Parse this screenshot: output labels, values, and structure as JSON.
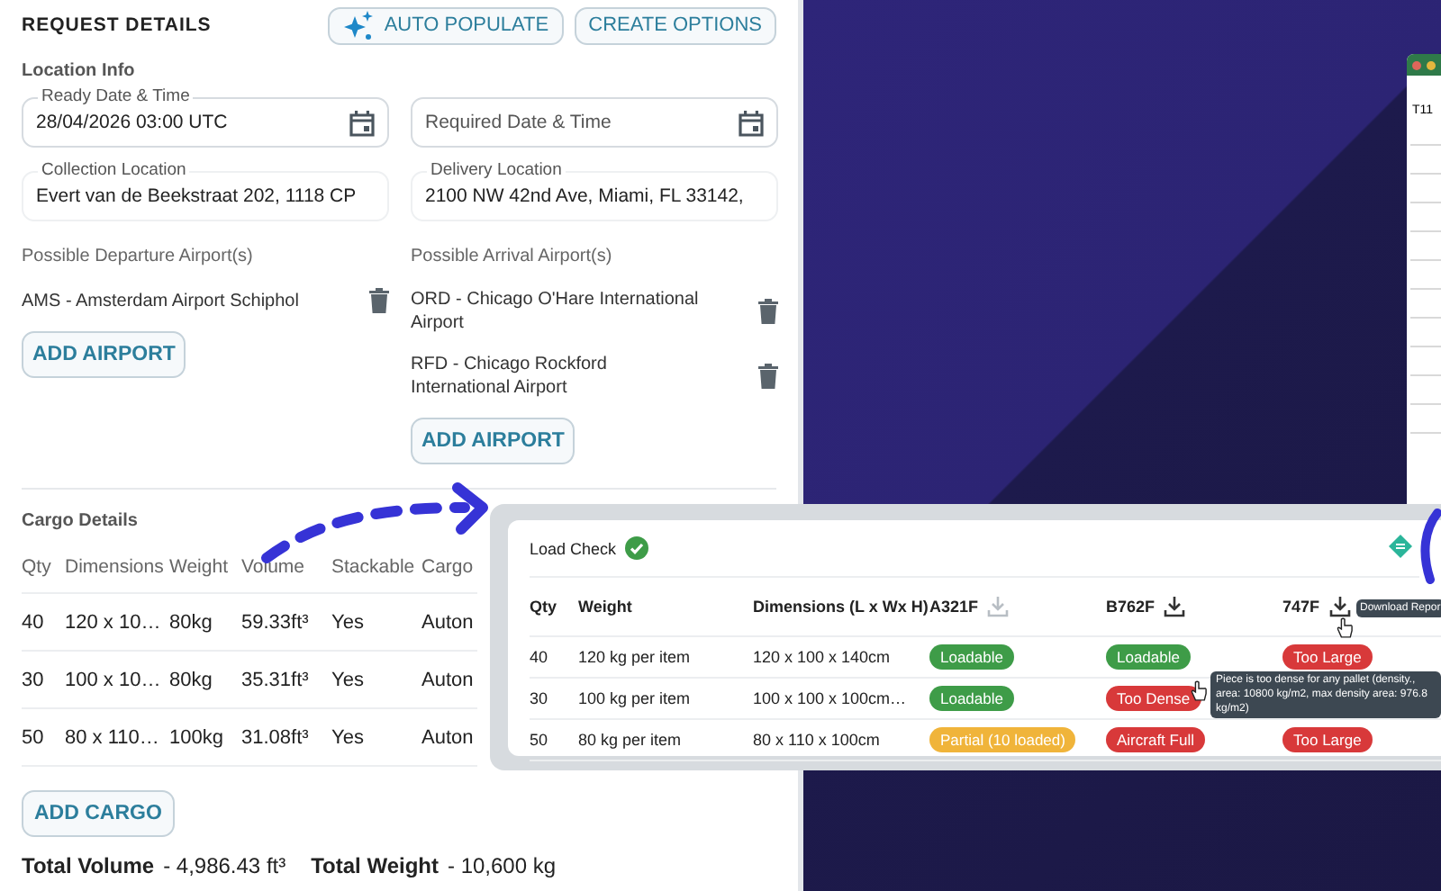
{
  "header": {
    "title": "REQUEST DETAILS",
    "buttons": [
      {
        "label": "AUTO POPULATE",
        "kind": "sparkle"
      },
      {
        "label": "CREATE OPTIONS",
        "kind": "plain"
      }
    ]
  },
  "location_info": {
    "heading": "Location Info",
    "fields": [
      {
        "label": "Ready Date & Time",
        "value": "28/04/2026 03:00 UTC",
        "kind": "date"
      },
      {
        "placeholder": "Required Date & Time",
        "kind": "date"
      },
      {
        "label": "Collection Location",
        "value": "Evert van de Beekstraat 202, 1118 CP",
        "kind": "text"
      },
      {
        "label": "Delivery Location",
        "value": "2100 NW 42nd Ave, Miami, FL 33142,",
        "kind": "text"
      }
    ]
  },
  "departure": {
    "heading": "Possible Departure Airport(s)",
    "airports": [
      "AMS - Amsterdam Airport Schiphol"
    ],
    "add_button": "ADD AIRPORT"
  },
  "arrival": {
    "heading": "Possible Arrival Airport(s)",
    "airports": [
      "ORD - Chicago O'Hare International Airport",
      "RFD - Chicago Rockford International Airport"
    ],
    "add_button": "ADD AIRPORT"
  },
  "cargo": {
    "heading": "Cargo Details",
    "columns": [
      "Qty",
      "Dimensions",
      "Weight",
      "Volume",
      "Stackable",
      "Cargo"
    ],
    "rows": [
      [
        "40",
        "120 x 10…",
        "80kg",
        "59.33ft³",
        "Yes",
        "Auton"
      ],
      [
        "30",
        "100 x 10…",
        "80kg",
        "35.31ft³",
        "Yes",
        "Auton"
      ],
      [
        "50",
        "80 x 110…",
        "100kg",
        "31.08ft³",
        "Yes",
        "Auton"
      ]
    ],
    "add_button": "ADD CARGO"
  },
  "totals": [
    {
      "label": "Total Volume",
      "value": "- 4,986.43 ft³"
    },
    {
      "label": "Total Weight",
      "value": "- 10,600 kg"
    }
  ],
  "load_check": {
    "title": "Load Check",
    "passed": true,
    "columns": [
      {
        "label": "Qty",
        "kind": "text"
      },
      {
        "label": "Weight",
        "kind": "text"
      },
      {
        "label": "Dimensions (L x Wx H)",
        "kind": "text"
      },
      {
        "label": "A321F",
        "kind": "aircraft",
        "disabled": true
      },
      {
        "label": "B762F",
        "kind": "aircraft",
        "disabled": false
      },
      {
        "label": "747F",
        "kind": "aircraft",
        "disabled": false
      }
    ],
    "rows": [
      {
        "qty": "40",
        "weight": "120 kg per item",
        "dimensions": "120 x 100 x 140cm",
        "results": [
          {
            "text": "Loadable",
            "color": "#3e9c48"
          },
          {
            "text": "Loadable",
            "color": "#3e9c48"
          },
          {
            "text": "Too Large",
            "color": "#d8393a"
          }
        ]
      },
      {
        "qty": "30",
        "weight": "100 kg per item",
        "dimensions": "100 x 100 x 100cm…",
        "results": [
          {
            "text": "Loadable",
            "color": "#3e9c48"
          },
          {
            "text": "Too Dense",
            "color": "#d8393a"
          }
        ]
      },
      {
        "qty": "50",
        "weight": "80 kg per item",
        "dimensions": "80 x 110 x 100cm",
        "results": [
          {
            "text": "Partial (10 loaded)",
            "color": "#f0b43a"
          },
          {
            "text": "Aircraft Full",
            "color": "#d8393a"
          },
          {
            "text": "Too Large",
            "color": "#d8393a"
          }
        ]
      }
    ],
    "tooltips": [
      {
        "text": "Download Repor",
        "kind": "header"
      },
      {
        "text": "Piece is too dense for any pallet (density., area: 10800 kg/m2, max density area: 976.8 kg/m2)",
        "kind": "cell"
      }
    ]
  },
  "spreadsheet": {
    "cell_ref": "T11"
  }
}
